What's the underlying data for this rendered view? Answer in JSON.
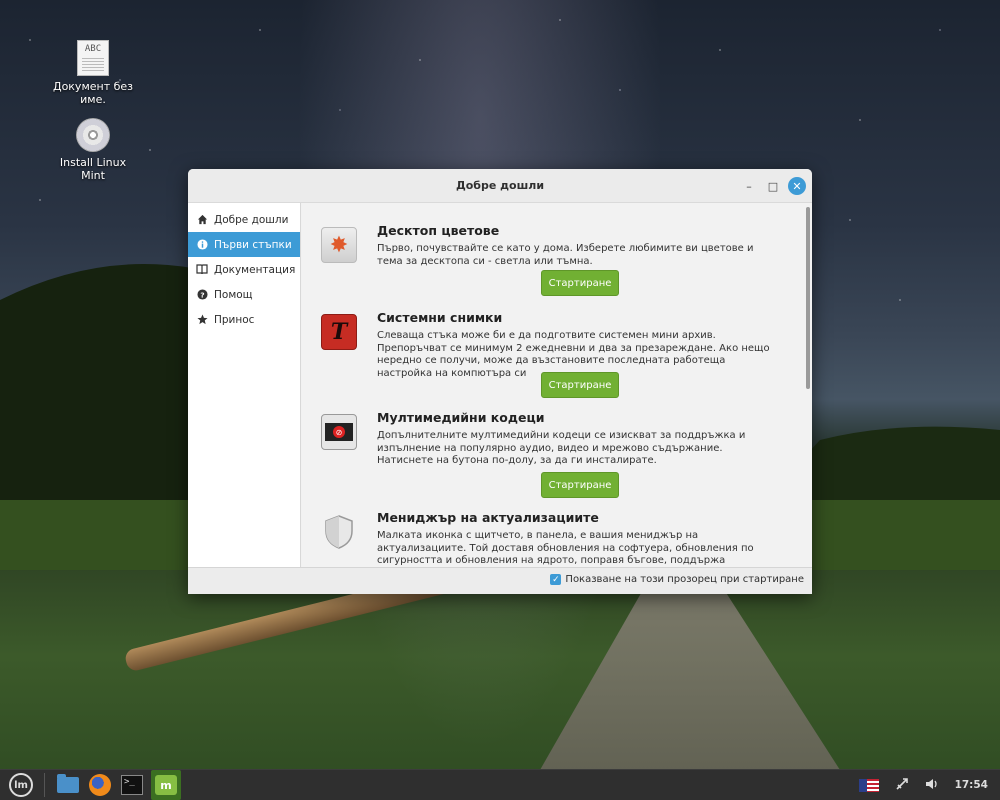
{
  "desktop": {
    "icons": [
      {
        "label": "Документ без име."
      },
      {
        "label": "Install Linux Mint"
      }
    ]
  },
  "window": {
    "title": "Добре дошли",
    "controls": {
      "minimize": "–",
      "maximize": "□",
      "close": "✕"
    }
  },
  "sidebar": {
    "items": [
      {
        "label": "Добре дошли",
        "icon": "home-icon"
      },
      {
        "label": "Първи стъпки",
        "icon": "info-icon",
        "active": true
      },
      {
        "label": "Документация",
        "icon": "book-icon"
      },
      {
        "label": "Помощ",
        "icon": "help-icon"
      },
      {
        "label": "Принос",
        "icon": "star-icon"
      }
    ]
  },
  "content": {
    "items": [
      {
        "title": "Десктоп цветове",
        "text": "Първо, почувствайте се като у дома. Изберете любимите ви цветове и тема за десктопа си - светла или тъмна.",
        "button": "Стартиране"
      },
      {
        "title": "Системни снимки",
        "text": "Слеваща стъка може би е да подготвите системен мини архив. Препоръчват се минимум 2 ежедневни и два за презареждане. Ако нещо нередно се получи, може да възстановите последната работеща настройка на компютъра си",
        "button": "Стартиране"
      },
      {
        "title": "Мултимедийни кодеци",
        "text": "Допълнителните мултимедийни кодеци се изискват за поддръжка и изпълнение на популярно аудио, видео и мрежово съдържание. Натиснете на бутона по-долу, за да ги инсталирате.",
        "button": "Стартиране"
      },
      {
        "title": "Мениджър на актуализациите",
        "text": "Малката иконка с щитчето, в панела, е вашия мениджър на актуализациите. Той доставя обновления на софтуера, обновления по сигурността и обновления на ядрото, поправя бъгове, поддържа компютъра сигурен и осигурява по-нова"
      }
    ]
  },
  "footer": {
    "checkbox_label": "Показване на този прозорец при стартиране",
    "checked": true
  },
  "taskbar": {
    "terminal_glyph": ">_",
    "mint_glyph": "m",
    "clock": "17:54",
    "language": "en_US"
  },
  "colors": {
    "accent": "#3d9bd6",
    "button_green": "#71b033",
    "taskbar": "#2f2f2f"
  }
}
